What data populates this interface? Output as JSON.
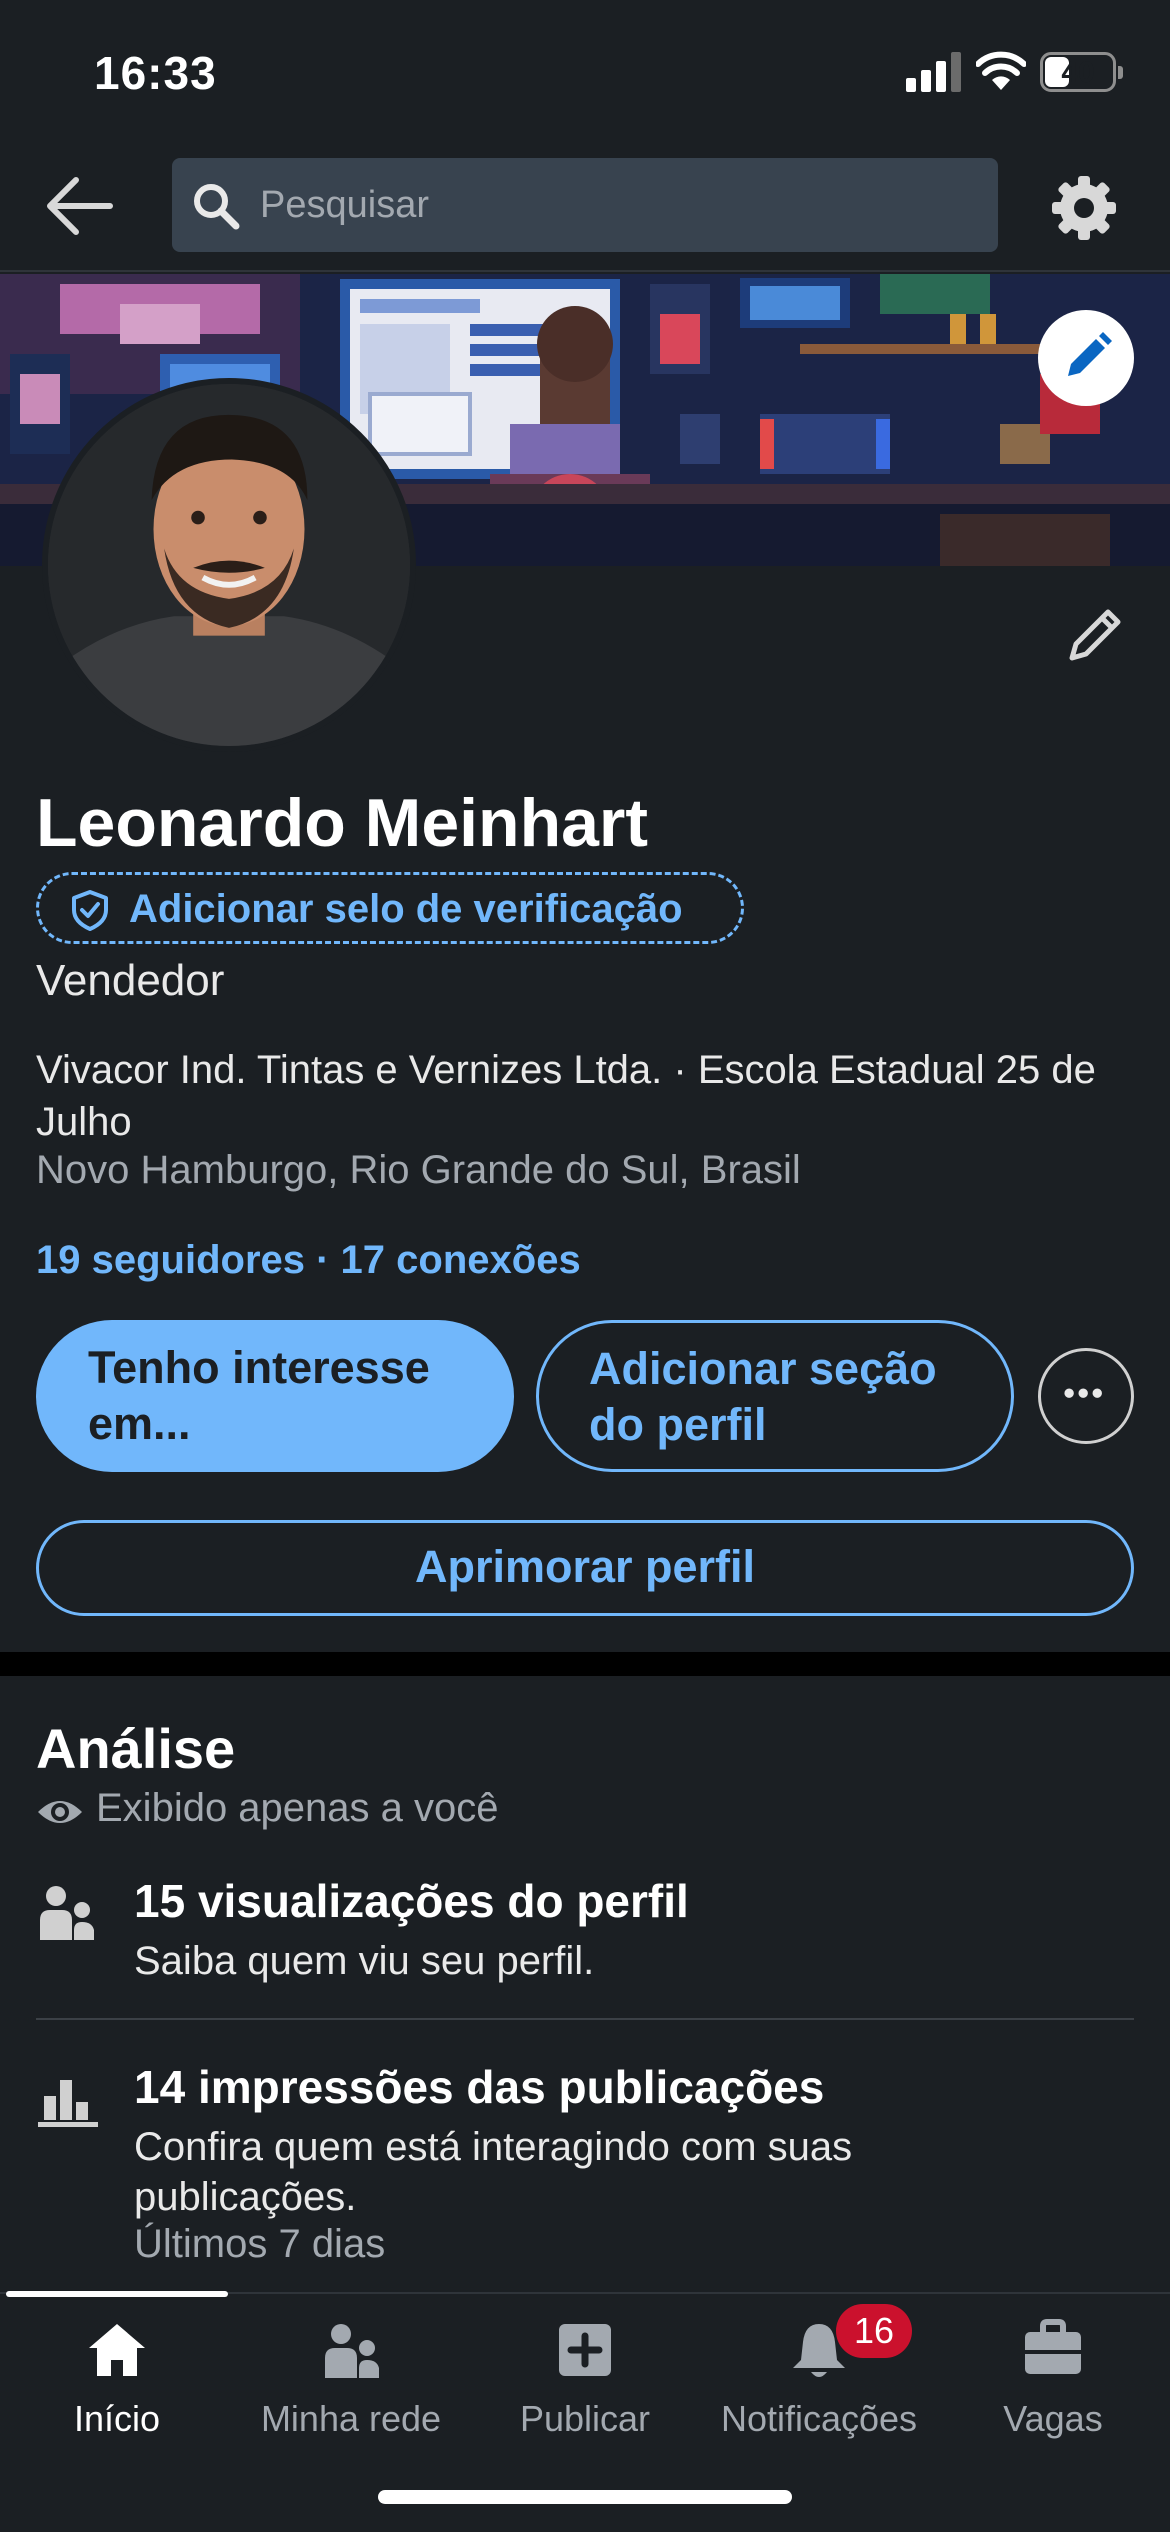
{
  "status_bar": {
    "time": "16:33",
    "battery": "40",
    "battery_level_percent": 40
  },
  "top_nav": {
    "search_placeholder": "Pesquisar",
    "icons": [
      "arrow-left-icon",
      "search-icon",
      "gear-icon"
    ]
  },
  "profile": {
    "name": "Leonardo Meinhart",
    "verify_label": "Adicionar selo de verificação",
    "headline": "Vendedor",
    "experience": "Vivacor Ind. Tintas e Vernizes Ltda. · Escola Estadual 25 de Julho",
    "location": "Novo Hamburgo, Rio Grande do Sul, Brasil",
    "connections": "19 seguidores · 17 conexões",
    "buttons": {
      "primary": "Tenho interesse em...",
      "secondary": "Adicionar seção do perfil",
      "improve": "Aprimorar perfil"
    }
  },
  "analytics": {
    "title": "Análise",
    "private_label": "Exibido apenas a você",
    "metrics": [
      {
        "icon": "people-icon",
        "title": "15 visualizações do perfil",
        "subtitle": "Saiba quem viu seu perfil."
      },
      {
        "icon": "bar-chart-icon",
        "title": "14 impressões das publicações",
        "subtitle": "Confira quem está interagindo com suas publicações.",
        "note": "Últimos 7 dias"
      }
    ]
  },
  "bottom_nav": {
    "items": [
      {
        "label": "Início",
        "icon": "home-icon",
        "active": true
      },
      {
        "label": "Minha rede",
        "icon": "network-icon"
      },
      {
        "label": "Publicar",
        "icon": "plus-square-icon"
      },
      {
        "label": "Notificações",
        "icon": "bell-icon",
        "badge": "16"
      },
      {
        "label": "Vagas",
        "icon": "briefcase-icon"
      }
    ]
  },
  "colors": {
    "background": "#1b1f23",
    "accent": "#71b7fb",
    "badge": "#cb112d",
    "muted_text": "#a3a9b0"
  }
}
